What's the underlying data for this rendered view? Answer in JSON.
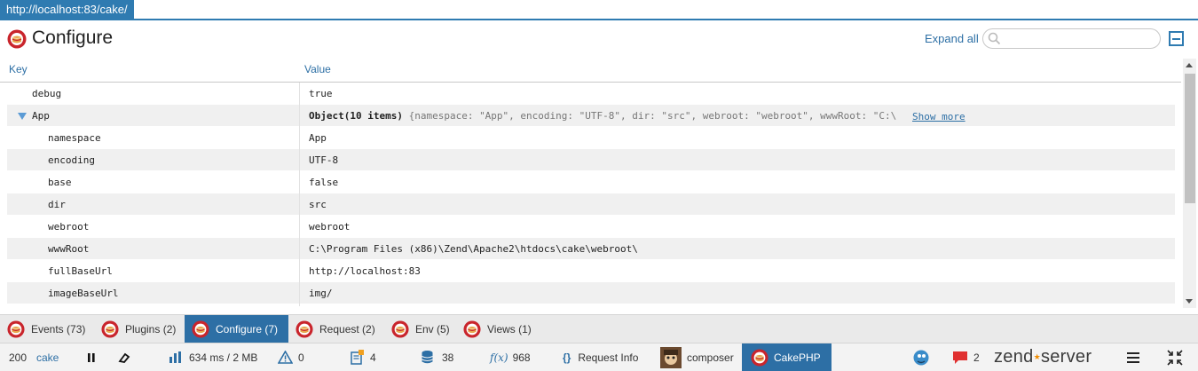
{
  "url": "http://localhost:83/cake/",
  "header": {
    "title": "Configure",
    "expand_all": "Expand all",
    "search_placeholder": "",
    "collapse_icon": "minus-square-icon"
  },
  "columns": {
    "key": "Key",
    "value": "Value"
  },
  "rows": [
    {
      "key": "debug",
      "value": "true"
    },
    {
      "key": "App",
      "value_strong": "Object(10 items)",
      "value_summary": "{namespace: \"App\", encoding: \"UTF-8\", dir: \"src\", webroot: \"webroot\", wwwRoot: \"C:\\",
      "show_more": "Show more"
    },
    {
      "key": "namespace",
      "value": "App"
    },
    {
      "key": "encoding",
      "value": "UTF-8"
    },
    {
      "key": "base",
      "value": "false"
    },
    {
      "key": "dir",
      "value": "src"
    },
    {
      "key": "webroot",
      "value": "webroot"
    },
    {
      "key": "wwwRoot",
      "value": "C:\\Program Files (x86)\\Zend\\Apache2\\htdocs\\cake\\webroot\\"
    },
    {
      "key": "fullBaseUrl",
      "value": "http://localhost:83"
    },
    {
      "key": "imageBaseUrl",
      "value": "img/"
    }
  ],
  "tabs": [
    {
      "label": "Events (73)"
    },
    {
      "label": "Plugins (2)"
    },
    {
      "label": "Configure (7)",
      "active": true
    },
    {
      "label": "Request (2)"
    },
    {
      "label": "Env (5)"
    },
    {
      "label": "Views (1)"
    }
  ],
  "status": {
    "code": "200",
    "app": "cake",
    "time_mem": "634 ms / 2 MB",
    "warnings": "0",
    "notes": "4",
    "queries": "38",
    "functions": "968",
    "request_info": "Request Info",
    "composer": "composer",
    "cakephp": "CakePHP",
    "messages": "2",
    "brand": "zend",
    "brand2": "server"
  },
  "colors": {
    "accent": "#2d6fa5",
    "cake_red": "#c9252c",
    "row_alt": "#f0f0f0"
  }
}
